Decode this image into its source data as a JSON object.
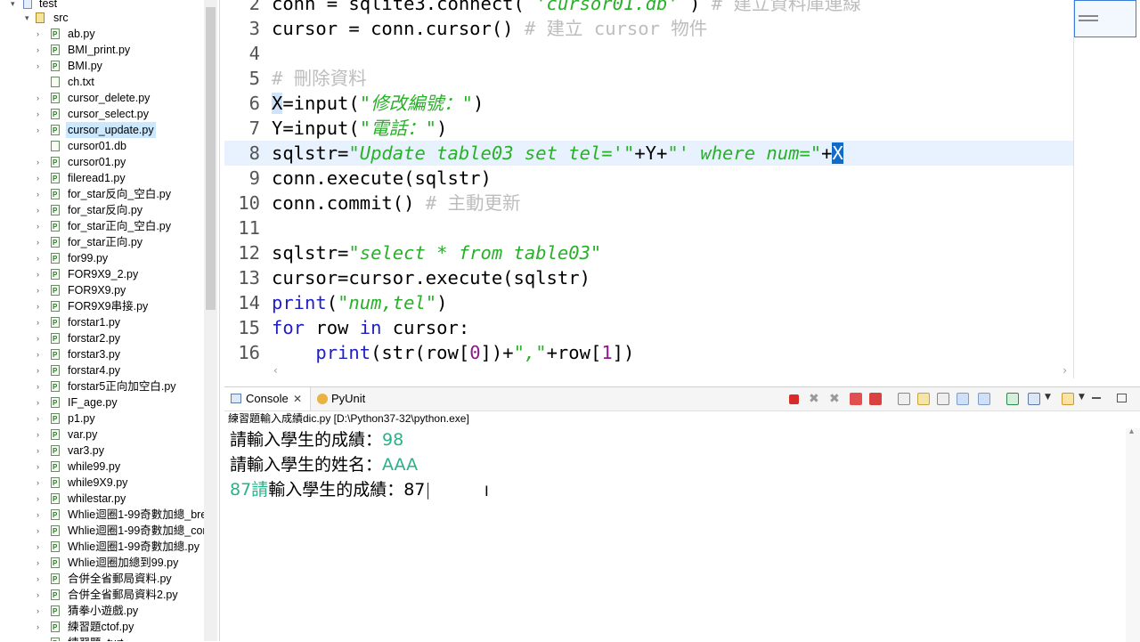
{
  "explorer": {
    "project": "test",
    "folder": "src",
    "files": [
      "ab.py",
      "BMI_print.py",
      "BMI.py",
      "ch.txt",
      "cursor_delete.py",
      "cursor_select.py",
      "cursor_update.py",
      "cursor01.db",
      "cursor01.py",
      "fileread1.py",
      "for_star反向_空白.py",
      "for_star反向.py",
      "for_star正向_空白.py",
      "for_star正向.py",
      "for99.py",
      "FOR9X9_2.py",
      "FOR9X9.py",
      "FOR9X9串接.py",
      "forstar1.py",
      "forstar2.py",
      "forstar3.py",
      "forstar4.py",
      "forstar5正向加空白.py",
      "IF_age.py",
      "p1.py",
      "var.py",
      "var3.py",
      "while99.py",
      "while9X9.py",
      "whilestar.py",
      "Whlie迴圈1-99奇數加總_bre",
      "Whlie迴圈1-99奇數加總_cor",
      "Whlie迴圈1-99奇數加總.py",
      "Whlie迴圈加總到99.py",
      "合併全省郵局資料.py",
      "合併全省郵局資料2.py",
      "猜拳小遊戲.py",
      "練習題ctof.py",
      "練習題_turt"
    ],
    "selected": "cursor_update.py"
  },
  "editor": {
    "lines": [
      {
        "n": "2",
        "html": "conn = sqlite3.connect( <span class=\"str\">'cursor01.db'</span> ) <span class=\"cmt\"># 建立資料庫連線</span>"
      },
      {
        "n": "3",
        "html": "cursor = conn.cursor() <span class=\"cmt\"># 建立 cursor 物件</span>"
      },
      {
        "n": "4",
        "html": ""
      },
      {
        "n": "5",
        "html": "<span class=\"cmt\"># 刪除資料</span>"
      },
      {
        "n": "6",
        "html": "<span class=\"hl\">X</span>=input(<span class=\"str\">\"修改編號：\"</span>)"
      },
      {
        "n": "7",
        "html": "Y=input(<span class=\"str\">\"電話：\"</span>)"
      },
      {
        "n": "8",
        "html": "sqlstr=<span class=\"str\">\"Update table03 set tel='\"</span>+Y+<span class=\"str\">\"' where num=\"</span>+<span class=\"sel\">X</span>"
      },
      {
        "n": "9",
        "html": "conn.execute(sqlstr)"
      },
      {
        "n": "10",
        "html": "conn.commit() <span class=\"cmt\"># 主動更新</span>"
      },
      {
        "n": "11",
        "html": ""
      },
      {
        "n": "12",
        "html": "sqlstr=<span class=\"str\">\"select * from table03\"</span>"
      },
      {
        "n": "13",
        "html": "cursor=cursor.execute(sqlstr)"
      },
      {
        "n": "14",
        "html": "<span class=\"kw\">print</span>(<span class=\"str\">\"num,tel\"</span>)"
      },
      {
        "n": "15",
        "html": "<span class=\"kw\">for</span> row <span class=\"kw\">in</span> cursor:"
      },
      {
        "n": "16",
        "html": "    <span class=\"kw\">print</span>(str(row[<span class=\"num\">0</span>])+<span class=\"str\">\",\"</span>+row[<span class=\"num\">1</span>])"
      }
    ]
  },
  "console": {
    "tab_console": "Console",
    "tab_pyunit": "PyUnit",
    "caption": "練習題輸入成績dic.py [D:\\Python37-32\\python.exe]",
    "output": [
      {
        "prompt": "請輸入學生的成績：",
        "input": "98"
      },
      {
        "prompt": "請輸入學生的姓名：",
        "input": "AAA"
      },
      {
        "prefix": "87",
        "prefix_tail": "請",
        "prompt": "輸入學生的成績：",
        "input": "87"
      }
    ]
  },
  "colors": {
    "selection": "#0f6ccb",
    "string": "#28b028",
    "keyword": "#1f1fc4",
    "console_input": "#28b28a"
  }
}
